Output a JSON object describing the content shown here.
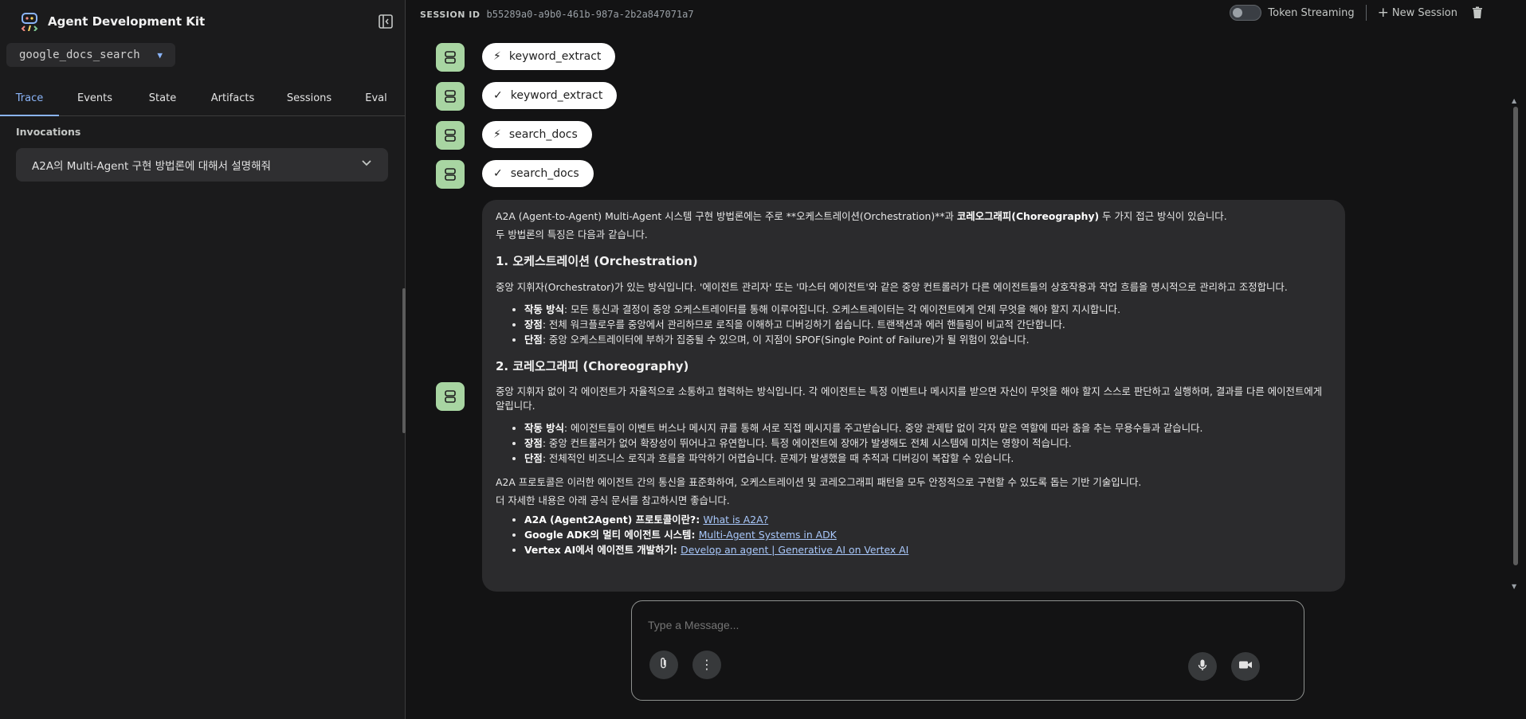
{
  "sidebar": {
    "app_title": "Agent Development Kit",
    "agent_select": "google_docs_search",
    "tabs": [
      {
        "label": "Trace",
        "active": true
      },
      {
        "label": "Events"
      },
      {
        "label": "State"
      },
      {
        "label": "Artifacts"
      },
      {
        "label": "Sessions"
      },
      {
        "label": "Eval"
      }
    ],
    "invocations_label": "Invocations",
    "invocation_item": "A2A의 Multi-Agent 구현 방법론에 대해서 설명해줘"
  },
  "topbar": {
    "session_label": "SESSION ID",
    "session_id": "b55289a0-a9b0-461b-987a-2b2a847071a7",
    "token_streaming": "Token Streaming",
    "new_session": "New Session"
  },
  "chips": [
    {
      "icon": "bolt-icon",
      "label": "keyword_extract"
    },
    {
      "icon": "check-icon",
      "label": "keyword_extract"
    },
    {
      "icon": "bolt-icon",
      "label": "search_docs"
    },
    {
      "icon": "check-icon",
      "label": "search_docs"
    }
  ],
  "message": {
    "intro_1a": "A2A (Agent-to-Agent) Multi-Agent 시스템 구현 방법론에는 주로 **오케스트레이션(Orchestration)**과 ",
    "intro_1b": "코레오그래피(Choreography)",
    "intro_1c": " 두 가지 접근 방식이 있습니다.",
    "intro_2": "두 방법론의 특징은 다음과 같습니다.",
    "h1": "1. 오케스트레이션 (Orchestration)",
    "p1": "중앙 지휘자(Orchestrator)가 있는 방식입니다. '에이전트 관리자' 또는 '마스터 에이전트'와 같은 중앙 컨트롤러가 다른 에이전트들의 상호작용과 작업 흐름을 명시적으로 관리하고 조정합니다.",
    "l1": [
      {
        "k": "작동 방식",
        "v": ": 모든 통신과 결정이 중앙 오케스트레이터를 통해 이루어집니다. 오케스트레이터는 각 에이전트에게 언제 무엇을 해야 할지 지시합니다."
      },
      {
        "k": "장점",
        "v": ": 전체 워크플로우를 중앙에서 관리하므로 로직을 이해하고 디버깅하기 쉽습니다. 트랜잭션과 에러 핸들링이 비교적 간단합니다."
      },
      {
        "k": "단점",
        "v": ": 중앙 오케스트레이터에 부하가 집중될 수 있으며, 이 지점이 SPOF(Single Point of Failure)가 될 위험이 있습니다."
      }
    ],
    "h2": "2. 코레오그래피 (Choreography)",
    "p2": "중앙 지휘자 없이 각 에이전트가 자율적으로 소통하고 협력하는 방식입니다. 각 에이전트는 특정 이벤트나 메시지를 받으면 자신이 무엇을 해야 할지 스스로 판단하고 실행하며, 결과를 다른 에이전트에게 알립니다.",
    "l2": [
      {
        "k": "작동 방식",
        "v": ": 에이전트들이 이벤트 버스나 메시지 큐를 통해 서로 직접 메시지를 주고받습니다. 중앙 관제탑 없이 각자 맡은 역할에 따라 춤을 추는 무용수들과 같습니다."
      },
      {
        "k": "장점",
        "v": ": 중앙 컨트롤러가 없어 확장성이 뛰어나고 유연합니다. 특정 에이전트에 장애가 발생해도 전체 시스템에 미치는 영향이 적습니다."
      },
      {
        "k": "단점",
        "v": ": 전체적인 비즈니스 로직과 흐름을 파악하기 어렵습니다. 문제가 발생했을 때 추적과 디버깅이 복잡할 수 있습니다."
      }
    ],
    "p3": "A2A 프로토콜은 이러한 에이전트 간의 통신을 표준화하여, 오케스트레이션 및 코레오그래피 패턴을 모두 안정적으로 구현할 수 있도록 돕는 기반 기술입니다.",
    "p4": "더 자세한 내용은 아래 공식 문서를 참고하시면 좋습니다.",
    "links": [
      {
        "k": "A2A (Agent2Agent) 프로토콜이란?",
        "link": "What is A2A?"
      },
      {
        "k": "Google ADK의 멀티 에이전트 시스템",
        "link": "Multi-Agent Systems in ADK"
      },
      {
        "k": "Vertex AI에서 에이전트 개발하기",
        "link": "Develop an agent | Generative AI on Vertex AI"
      }
    ]
  },
  "composer": {
    "placeholder": "Type a Message..."
  },
  "colors": {
    "accent": "#8ab4f8",
    "avatar": "#a8d5a2",
    "bubble": "#2b2b2d"
  }
}
